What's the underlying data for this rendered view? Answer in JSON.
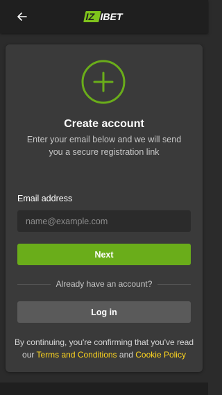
{
  "header": {
    "logo_text": "IZIBET",
    "logo_colors": {
      "iz": "#7fc31c",
      "bet": "#ffffff"
    }
  },
  "card": {
    "icon": "plus-circle-icon",
    "title": "Create account",
    "subtitle": "Enter your email below and we will send you a secure registration link",
    "email": {
      "label": "Email address",
      "placeholder": "name@example.com",
      "value": ""
    },
    "next_label": "Next",
    "divider_text": "Already have an account?",
    "login_label": "Log in",
    "terms": {
      "prefix": "By continuing, you're confirming that you've read our",
      "terms_link": "Terms and Conditions",
      "and": "and",
      "cookie_link": "Cookie Policy"
    }
  },
  "colors": {
    "accent": "#6aad1a",
    "link": "#ffd61f",
    "card_bg": "#3a3a3a",
    "page_bg": "#2b2b2b"
  }
}
